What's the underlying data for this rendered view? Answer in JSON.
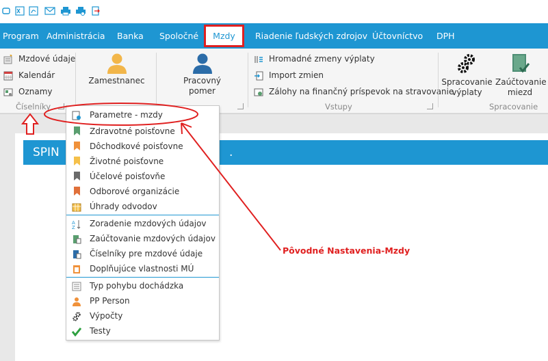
{
  "quick_access": {
    "icons": [
      "window-icon",
      "excel-icon",
      "pdf-icon",
      "email-icon",
      "print-icon",
      "print-preview-icon",
      "export-icon"
    ]
  },
  "menu": {
    "tabs": [
      {
        "label": "Program"
      },
      {
        "label": "Administrácia"
      },
      {
        "label": "Banka"
      },
      {
        "label": "Spoločné"
      },
      {
        "label": "Mzdy",
        "active": true
      },
      {
        "label": "Riadenie ľudských zdrojov"
      },
      {
        "label": "Účtovníctvo"
      },
      {
        "label": "DPH"
      }
    ],
    "active_tab": "Mzdy"
  },
  "ribbon": {
    "ciselniky": {
      "items": [
        "Mzdové údaje",
        "Kalendár",
        "Oznamy"
      ],
      "label": "Číselníky"
    },
    "zamestnanec": {
      "label": "Zamestnanec"
    },
    "pracovny_pomer": {
      "label": "Pracovný pomer"
    },
    "vstupy": {
      "items": [
        "Hromadné zmeny výplaty",
        "Import zmien",
        "Zálohy na finančný príspevok na stravovanie"
      ],
      "label": "Vstupy"
    },
    "spracovanie": {
      "spracovanie_vyplaty": "Spracovanie výplaty",
      "zauctovanie_miezd": "Zaúčtovanie miezd",
      "label": "Spracovanie"
    }
  },
  "content": {
    "banner_text_left": "SPIN",
    "banner_text_right": "."
  },
  "dropdown": {
    "items": [
      {
        "label": "Parametre - mzdy",
        "icon": "settings-icon"
      },
      {
        "label": "Zdravotné poisťovne",
        "icon": "bookmark-icon",
        "color": "#5a9e6f"
      },
      {
        "label": "Dôchodkové poisťovne",
        "icon": "bookmark-icon",
        "color": "#f0913a"
      },
      {
        "label": "Životné poisťovne",
        "icon": "bookmark-icon",
        "color": "#f5c04a"
      },
      {
        "label": "Účelové poisťovňe",
        "icon": "bookmark-icon",
        "color": "#6b6b6b"
      },
      {
        "label": "Odborové organizácie",
        "icon": "bookmark-icon",
        "color": "#e0703a"
      },
      {
        "label": "Úhrady odvodov",
        "icon": "calendar-grid-icon"
      },
      {
        "label": "Zoradenie mzdových údajov",
        "icon": "sort-az-icon"
      },
      {
        "label": "Zaúčtovanie mzdových údajov",
        "icon": "ledger-icon"
      },
      {
        "label": "Číselníky pre mzdové údaje",
        "icon": "list-icon"
      },
      {
        "label": "Doplňujúce vlastnosti MÚ",
        "icon": "properties-icon"
      },
      {
        "label": "Typ pohybu dochádzka",
        "icon": "list-lines-icon"
      },
      {
        "label": "PP Person",
        "icon": "person-icon"
      },
      {
        "label": "Výpočty",
        "icon": "gears-icon"
      },
      {
        "label": "Testy",
        "icon": "checkmark-icon"
      }
    ]
  },
  "annotation": {
    "label": "Pôvodné Nastavenia-Mzdy"
  },
  "colors": {
    "accent": "#1e96d2",
    "annotation": "#e02020",
    "ribbon_bg": "#f5f5f5"
  }
}
